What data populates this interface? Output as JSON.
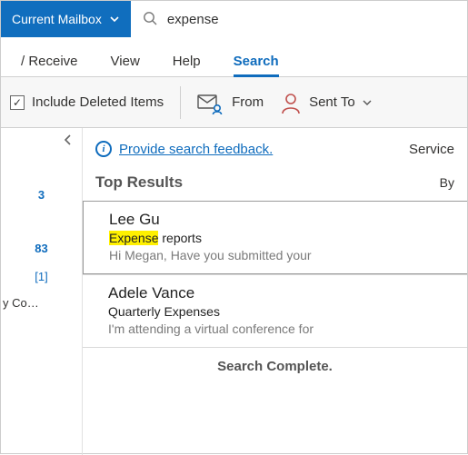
{
  "search": {
    "scope_label": "Current Mailbox",
    "query": "expense"
  },
  "tabs": {
    "items": [
      {
        "label": "/ Receive"
      },
      {
        "label": "View"
      },
      {
        "label": "Help"
      },
      {
        "label": "Search",
        "active": true
      }
    ]
  },
  "ribbon": {
    "include_deleted_label": "Include Deleted Items",
    "include_deleted_checked": true,
    "from_label": "From",
    "sent_to_label": "Sent To"
  },
  "sidebar": {
    "counts": {
      "a": "3",
      "b": "83",
      "c": "[1]"
    },
    "company_label": "y Co…"
  },
  "feedback": {
    "link": "Provide search feedback.",
    "service_partial": "Service"
  },
  "results": {
    "section_title": "Top Results",
    "by_label": "By",
    "items": [
      {
        "sender": "Lee Gu",
        "subject_pre": "Expense",
        "subject_rest": " reports",
        "preview": "Hi Megan,  Have you submitted your"
      },
      {
        "sender": "Adele Vance",
        "subject": "Quarterly Expenses",
        "preview": "I'm attending a virtual conference for"
      }
    ],
    "status": "Search Complete."
  }
}
